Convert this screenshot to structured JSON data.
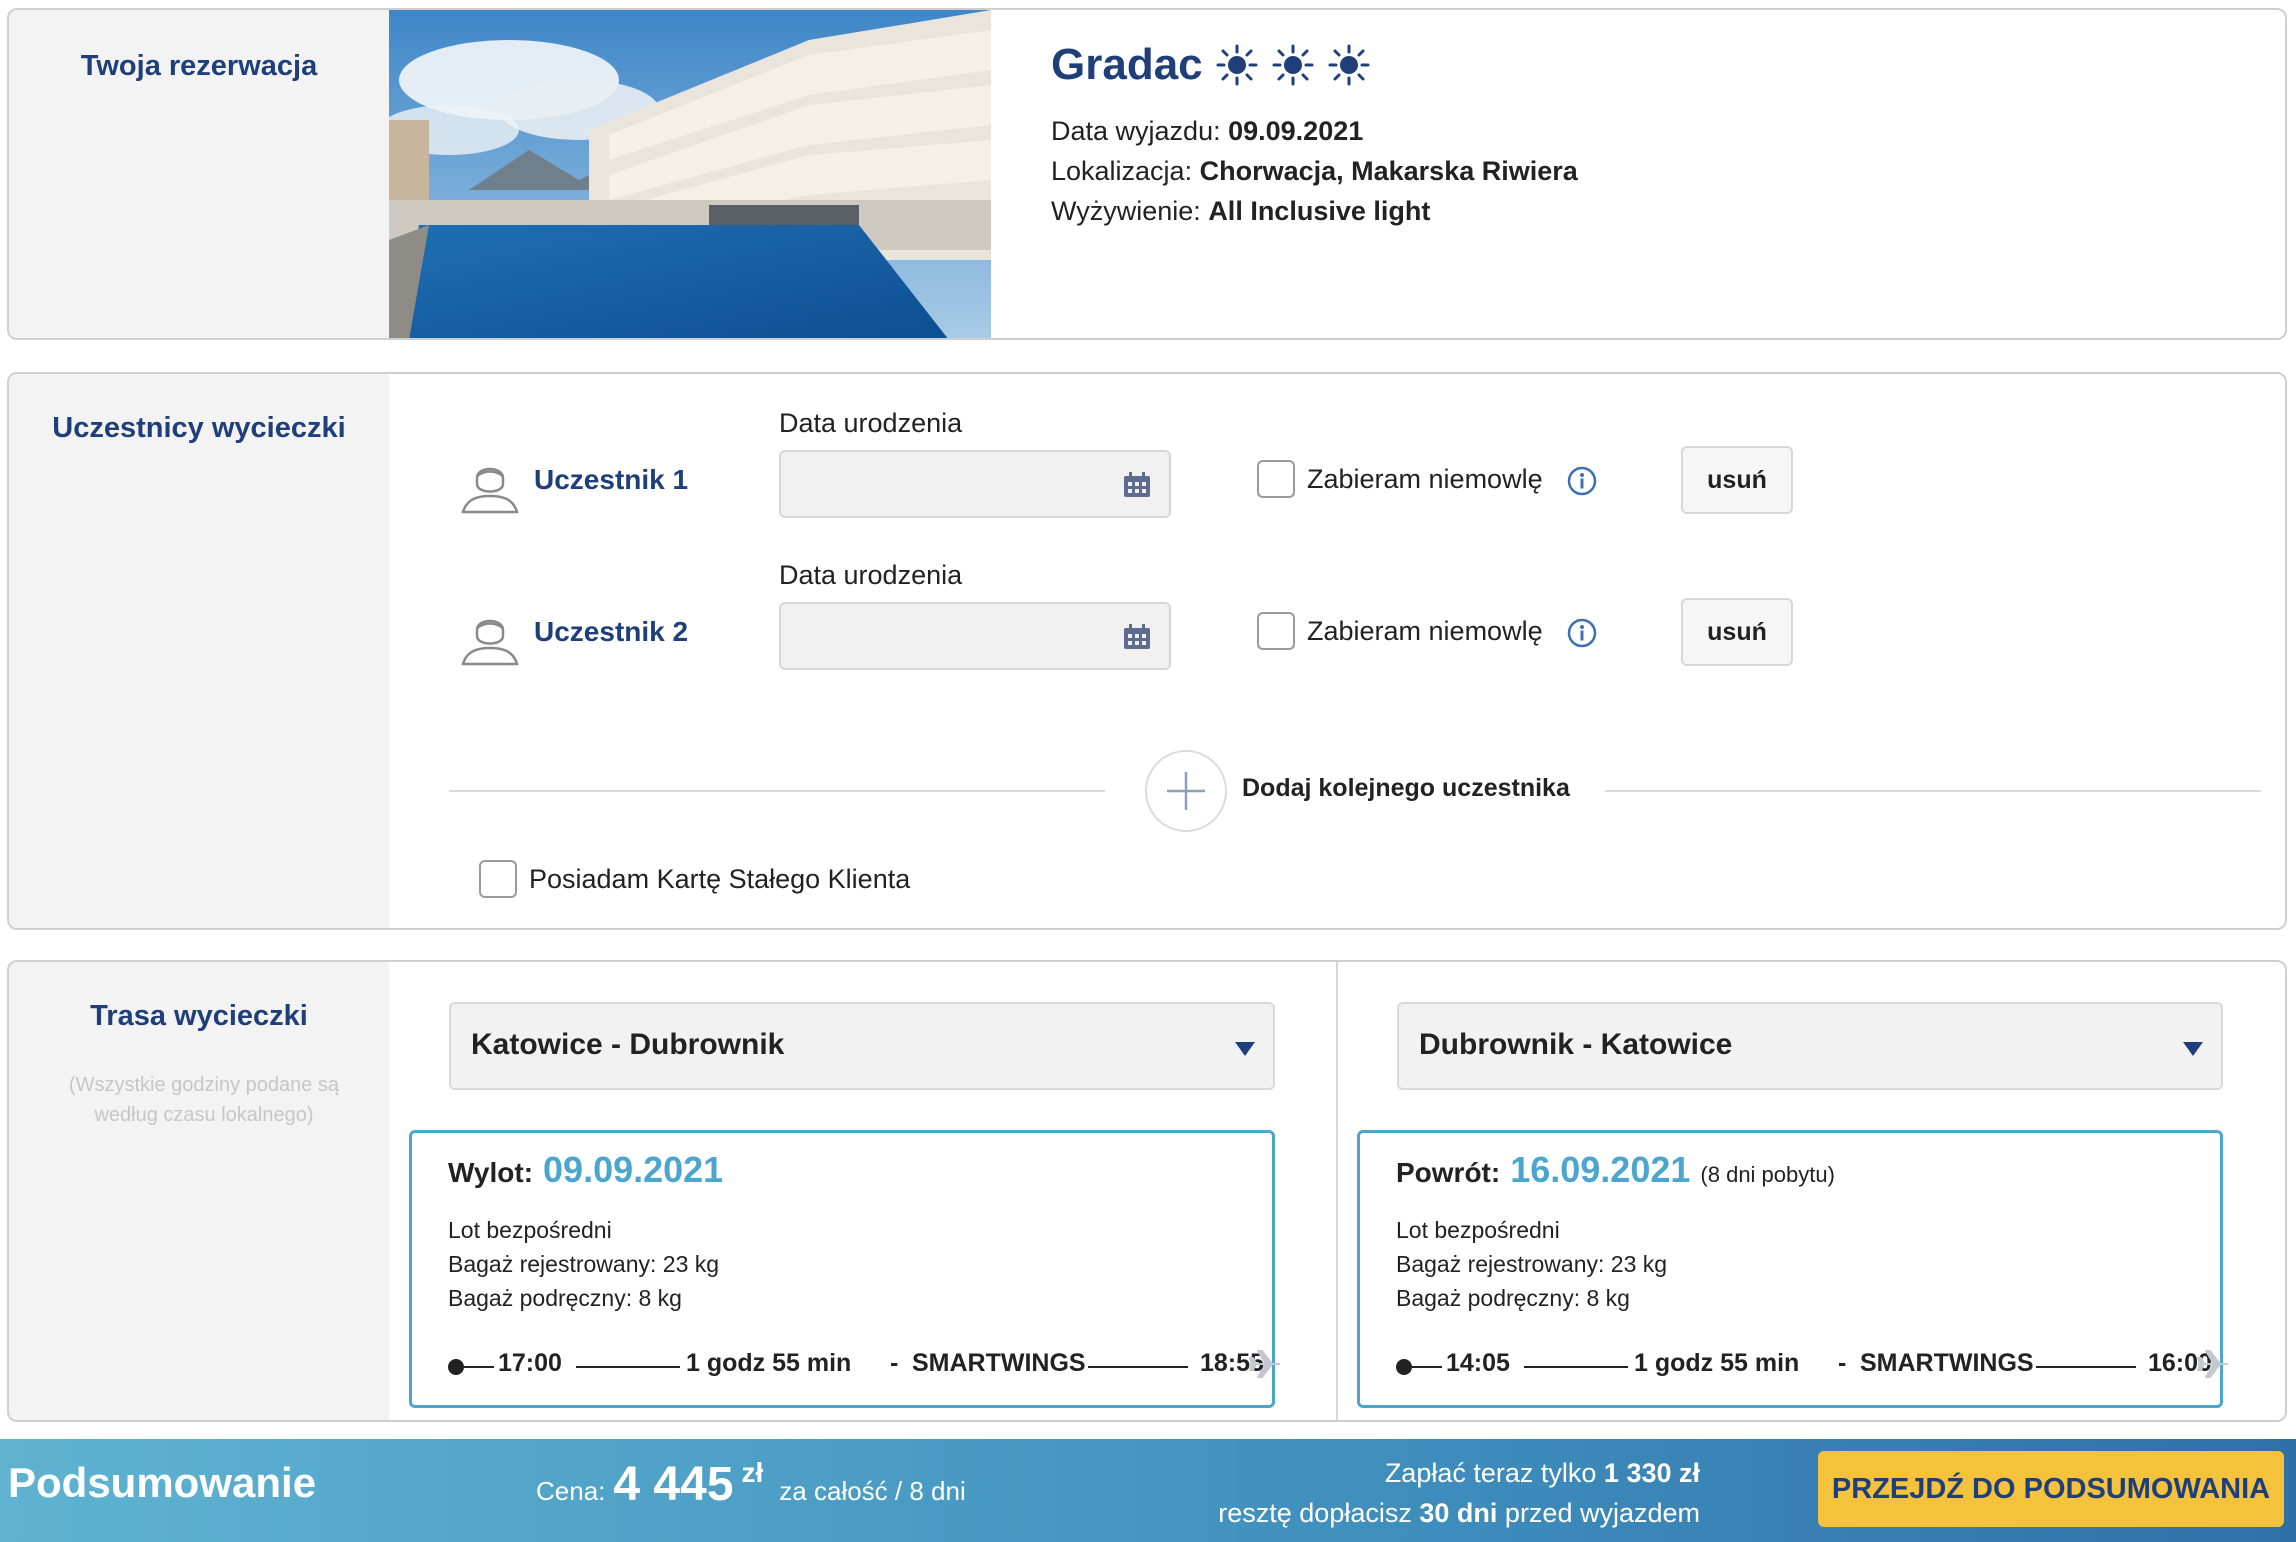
{
  "reservation": {
    "section_title": "Twoja rezerwacja",
    "hotel_name": "Gradac",
    "stars": 3,
    "departure_label": "Data wyjazdu:",
    "departure_value": "09.09.2021",
    "location_label": "Lokalizacja:",
    "location_value": "Chorwacja, Makarska Riwiera",
    "board_label": "Wyżywienie:",
    "board_value": "All Inclusive light"
  },
  "participants": {
    "section_title": "Uczestnicy wycieczki",
    "items": [
      {
        "name": "Uczestnik 1",
        "dob_label": "Data urodzenia",
        "dob_value": "",
        "infant_label": "Zabieram niemowlę",
        "remove_label": "usuń"
      },
      {
        "name": "Uczestnik 2",
        "dob_label": "Data urodzenia",
        "dob_value": "",
        "infant_label": "Zabieram niemowlę",
        "remove_label": "usuń"
      }
    ],
    "add_label": "Dodaj kolejnego uczestnika",
    "loyalty_label": "Posiadam Kartę Stałego Klienta"
  },
  "route": {
    "section_title": "Trasa wycieczki",
    "note": "(Wszystkie godziny podane są według czasu lokalnego)",
    "outbound": {
      "select_value": "Katowice - Dubrownik",
      "head_label": "Wylot:",
      "date": "09.09.2021",
      "stay": "",
      "line1": "Lot bezpośredni",
      "line2": "Bagaż rejestrowany: 23 kg",
      "line3": "Bagaż podręczny: 8 kg",
      "dep_time": "17:00",
      "duration": "1 godz 55 min",
      "sep": "-",
      "carrier": "SMARTWINGS",
      "arr_time": "18:55"
    },
    "inbound": {
      "select_value": "Dubrownik - Katowice",
      "head_label": "Powrót:",
      "date": "16.09.2021",
      "stay": "(8 dni pobytu)",
      "line1": "Lot bezpośredni",
      "line2": "Bagaż rejestrowany: 23 kg",
      "line3": "Bagaż podręczny: 8 kg",
      "dep_time": "14:05",
      "duration": "1 godz 55 min",
      "sep": "-",
      "carrier": "SMARTWINGS",
      "arr_time": "16:00"
    }
  },
  "summary": {
    "title": "Podsumowanie",
    "price_label": "Cena:",
    "price_value": "4 445",
    "price_currency": "zł",
    "price_suffix": "za całość / 8 dni",
    "pay_now_prefix": "Zapłać teraz tylko",
    "pay_now_value": "1 330 zł",
    "rest_prefix": "resztę dopłacisz",
    "rest_value": "30 dni",
    "rest_suffix": "przed wyjazdem",
    "cta_label": "PRZEJDŹ DO PODSUMOWANIA"
  },
  "colors": {
    "brand_navy": "#1e3f7a",
    "accent_blue": "#4aa6cf",
    "cta_yellow": "#f5c33b"
  }
}
